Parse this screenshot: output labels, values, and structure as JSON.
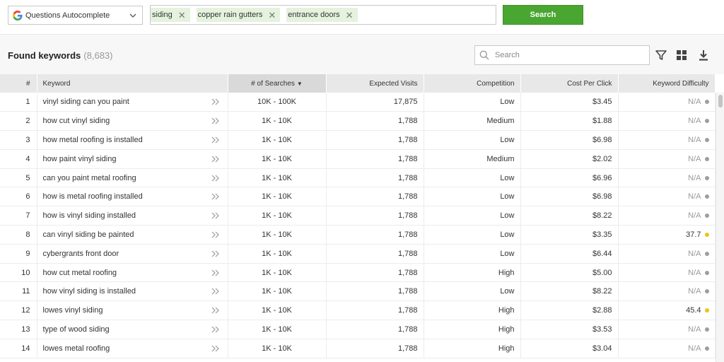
{
  "toolbar": {
    "source_label": "Questions Autocomplete",
    "tags": [
      {
        "label": "siding"
      },
      {
        "label": "copper rain gutters"
      },
      {
        "label": "entrance doors"
      }
    ],
    "tag_remove_glyph": "✕",
    "search_label": "Search"
  },
  "results": {
    "title": "Found keywords",
    "count": "(8,683)",
    "search_placeholder": "Search"
  },
  "table": {
    "headers": {
      "num": "#",
      "keyword": "Keyword",
      "searches": "# of Searches",
      "visits": "Expected Visits",
      "competition": "Competition",
      "cpc": "Cost Per Click",
      "difficulty": "Keyword Difficulty"
    },
    "rows": [
      {
        "num": "1",
        "keyword": "vinyl siding can you paint",
        "searches": "10K - 100K",
        "visits": "17,875",
        "competition": "Low",
        "cpc": "$3.45",
        "difficulty": "N/A",
        "dot": "#9e9e9e"
      },
      {
        "num": "2",
        "keyword": "how cut vinyl siding",
        "searches": "1K - 10K",
        "visits": "1,788",
        "competition": "Medium",
        "cpc": "$1.88",
        "difficulty": "N/A",
        "dot": "#9e9e9e"
      },
      {
        "num": "3",
        "keyword": "how metal roofing is installed",
        "searches": "1K - 10K",
        "visits": "1,788",
        "competition": "Low",
        "cpc": "$6.98",
        "difficulty": "N/A",
        "dot": "#9e9e9e"
      },
      {
        "num": "4",
        "keyword": "how paint vinyl siding",
        "searches": "1K - 10K",
        "visits": "1,788",
        "competition": "Medium",
        "cpc": "$2.02",
        "difficulty": "N/A",
        "dot": "#9e9e9e"
      },
      {
        "num": "5",
        "keyword": "can you paint metal roofing",
        "searches": "1K - 10K",
        "visits": "1,788",
        "competition": "Low",
        "cpc": "$6.96",
        "difficulty": "N/A",
        "dot": "#9e9e9e"
      },
      {
        "num": "6",
        "keyword": "how is metal roofing installed",
        "searches": "1K - 10K",
        "visits": "1,788",
        "competition": "Low",
        "cpc": "$6.98",
        "difficulty": "N/A",
        "dot": "#9e9e9e"
      },
      {
        "num": "7",
        "keyword": "how is vinyl siding installed",
        "searches": "1K - 10K",
        "visits": "1,788",
        "competition": "Low",
        "cpc": "$8.22",
        "difficulty": "N/A",
        "dot": "#9e9e9e"
      },
      {
        "num": "8",
        "keyword": "can vinyl siding be painted",
        "searches": "1K - 10K",
        "visits": "1,788",
        "competition": "Low",
        "cpc": "$3.35",
        "difficulty": "37.7",
        "dot": "#e6c619"
      },
      {
        "num": "9",
        "keyword": "cybergrants front door",
        "searches": "1K - 10K",
        "visits": "1,788",
        "competition": "Low",
        "cpc": "$6.44",
        "difficulty": "N/A",
        "dot": "#9e9e9e"
      },
      {
        "num": "10",
        "keyword": "how cut metal roofing",
        "searches": "1K - 10K",
        "visits": "1,788",
        "competition": "High",
        "cpc": "$5.00",
        "difficulty": "N/A",
        "dot": "#9e9e9e"
      },
      {
        "num": "11",
        "keyword": "how vinyl siding is installed",
        "searches": "1K - 10K",
        "visits": "1,788",
        "competition": "Low",
        "cpc": "$8.22",
        "difficulty": "N/A",
        "dot": "#9e9e9e"
      },
      {
        "num": "12",
        "keyword": "lowes vinyl siding",
        "searches": "1K - 10K",
        "visits": "1,788",
        "competition": "High",
        "cpc": "$2.88",
        "difficulty": "45.4",
        "dot": "#e6c619"
      },
      {
        "num": "13",
        "keyword": "type of wood siding",
        "searches": "1K - 10K",
        "visits": "1,788",
        "competition": "High",
        "cpc": "$3.53",
        "difficulty": "N/A",
        "dot": "#9e9e9e"
      },
      {
        "num": "14",
        "keyword": "lowes metal roofing",
        "searches": "1K - 10K",
        "visits": "1,788",
        "competition": "High",
        "cpc": "$3.04",
        "difficulty": "N/A",
        "dot": "#9e9e9e"
      }
    ]
  },
  "colors": {
    "accent_green": "#49a630",
    "tag_bg": "#e4f2de",
    "header_bg": "#e8e8e8",
    "na_dot": "#9e9e9e",
    "score_dot": "#e6c619"
  },
  "icons": {
    "source": "google-g-icon",
    "dropdown": "chevron-down-icon",
    "filter_search": "search-icon",
    "filter": "filter-icon",
    "layout": "grid-icon",
    "export": "download-icon",
    "expand": "double-chevron-right-icon"
  }
}
